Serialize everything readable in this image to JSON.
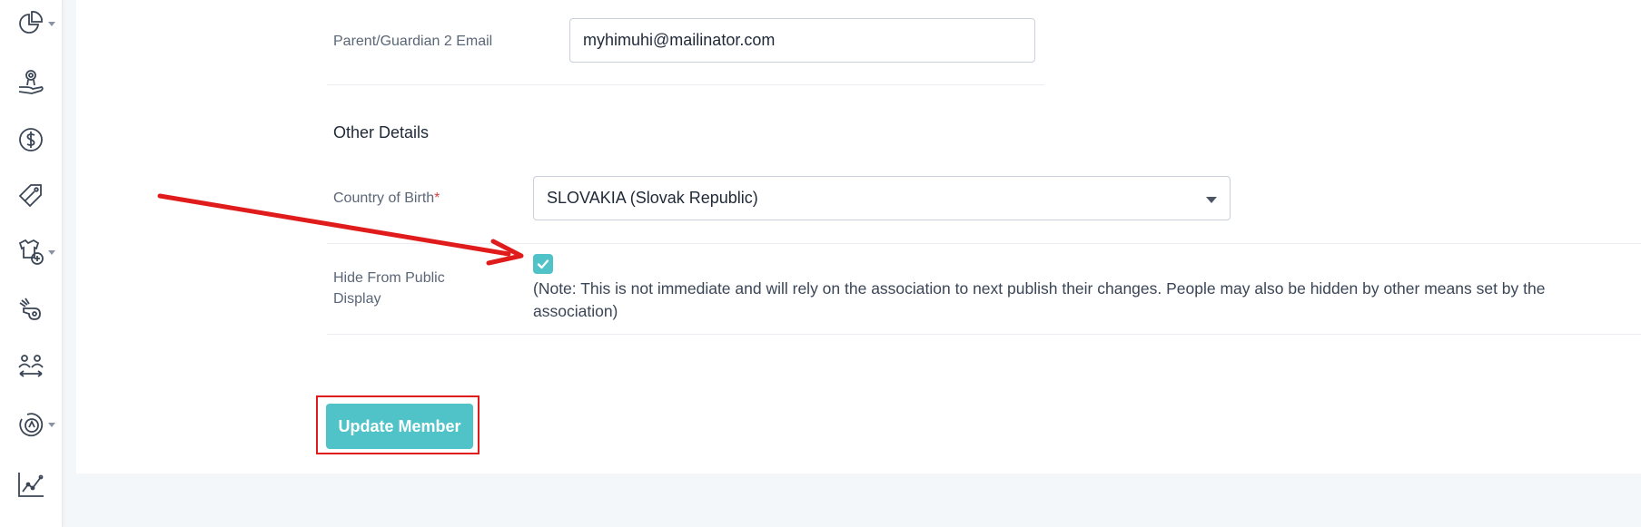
{
  "sidebar": {
    "items": [
      {
        "icon": "pie-chart-icon",
        "has_caret": true
      },
      {
        "icon": "hand-medal-icon",
        "has_caret": false
      },
      {
        "icon": "dollar-icon",
        "has_caret": false
      },
      {
        "icon": "tags-icon",
        "has_caret": false
      },
      {
        "icon": "jersey-add-icon",
        "has_caret": true
      },
      {
        "icon": "whistle-icon",
        "has_caret": false
      },
      {
        "icon": "people-transfer-icon",
        "has_caret": false
      },
      {
        "icon": "badge-icon",
        "has_caret": true
      },
      {
        "icon": "line-chart-icon",
        "has_caret": false
      }
    ]
  },
  "form": {
    "guardian2_email": {
      "label": "Parent/Guardian 2 Email",
      "value": "myhimuhi@mailinator.com"
    },
    "other_details_title": "Other Details",
    "country_of_birth": {
      "label": "Country of Birth",
      "required_mark": "*",
      "value": "SLOVAKIA (Slovak Republic)"
    },
    "hide_from_public": {
      "label": "Hide From Public Display",
      "checked": true,
      "note": "(Note: This is not immediate and will rely on the association to next publish their changes. People may also be hidden by other means set by the association)"
    },
    "submit_label": "Update Member"
  },
  "colors": {
    "accent": "#4fc3c7",
    "annotation_red": "#e01b1b"
  }
}
